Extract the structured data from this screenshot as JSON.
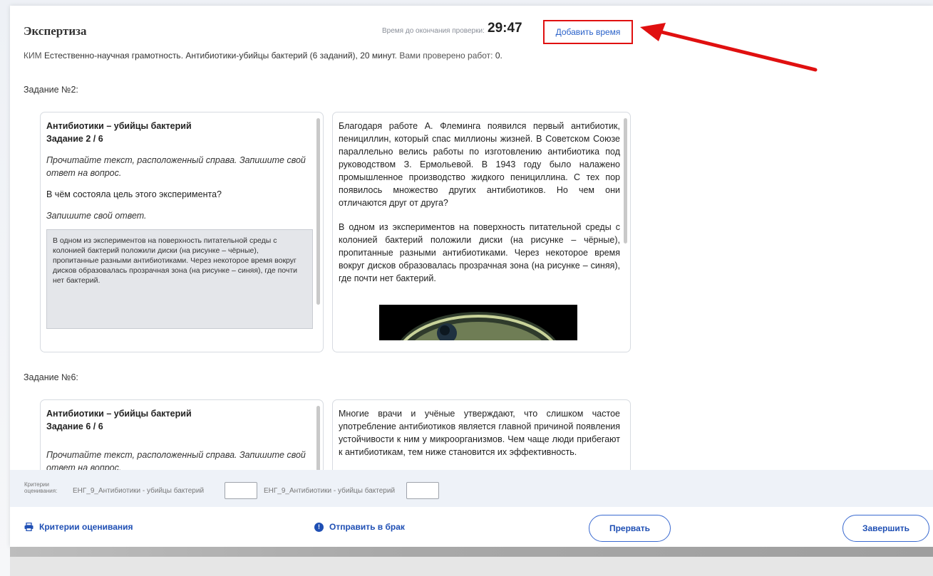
{
  "header": {
    "title": "Экспертиза",
    "timer_label": "Время до окончания проверки:",
    "timer_value": "29:47",
    "add_time_label": "Добавить время",
    "annotation_color": "#e01010"
  },
  "kim": {
    "prefix": "КИМ",
    "name": "Естественно-научная грамотность. Антибиотики-убийцы бактерий (6 заданий), 20 минут",
    "checked_text": ". Вами проверено работ: ",
    "checked_count": "0."
  },
  "tasks": [
    {
      "heading": "Задание №2:",
      "left": {
        "title": "Антибиотики – убийцы бактерий",
        "subtitle": "Задание 2 / 6",
        "instruction": "Прочитайте текст, расположенный справа. Запишите свой ответ на вопрос.",
        "question": "В чём состояла цель этого эксперимента?",
        "answer_prompt": "Запишите свой ответ.",
        "student_answer": "В одном из экспериментов на поверхность питательной среды с колонией бактерий положили диски (на рисунке – чёрные), пропитанные разными антибиотиками. Через некоторое время вокруг дисков образовалась прозрачная зона (на рисунке – синяя), где почти нет бактерий."
      },
      "right": {
        "paragraph1": "Благодаря работе А. Флеминга появился первый антибиотик, пенициллин, который спас миллионы жизней. В Советском Союзе параллельно велись работы по изготовлению антибиотика под руководством З. Ермольевой. В 1943 году было налажено промышленное производство жидкого пенициллина. С тех пор появилось множество других антибиотиков. Но чем они отличаются друг от друга?",
        "paragraph2": "В одном из экспериментов на поверхность питательной среды с колонией бактерий положили диски (на рисунке – чёрные), пропитанные разными антибиотиками. Через некоторое время вокруг дисков образовалась прозрачная зона (на рисунке – синяя), где почти нет бактерий."
      }
    },
    {
      "heading": "Задание №6:",
      "left": {
        "title": "Антибиотики – убийцы бактерий",
        "subtitle": "Задание 6 / 6",
        "instruction": "Прочитайте текст, расположенный справа. Запишите свой ответ на вопрос."
      },
      "right": {
        "paragraph1": "Многие врачи и учёные утверждают, что слишком частое употребление антибиотиков является главной причиной появления устойчивости к ним у микроорганизмов. Чем чаще люди прибегают к антибиотикам, тем ниже становится их эффективность."
      }
    }
  ],
  "criteria": {
    "label": "Критерии оценивания:",
    "items": [
      {
        "name": "ЕНГ_9_Антибиотики - убийцы бактерий",
        "value": ""
      },
      {
        "name": "ЕНГ_9_Антибиотики - убийцы бактерий",
        "value": ""
      }
    ]
  },
  "footer": {
    "criteria_link": "Критерии оценивания",
    "reject_link": "Отправить в брак",
    "interrupt_button": "Прервать",
    "finish_button": "Завершить",
    "accent_color": "#1f4fb4"
  }
}
